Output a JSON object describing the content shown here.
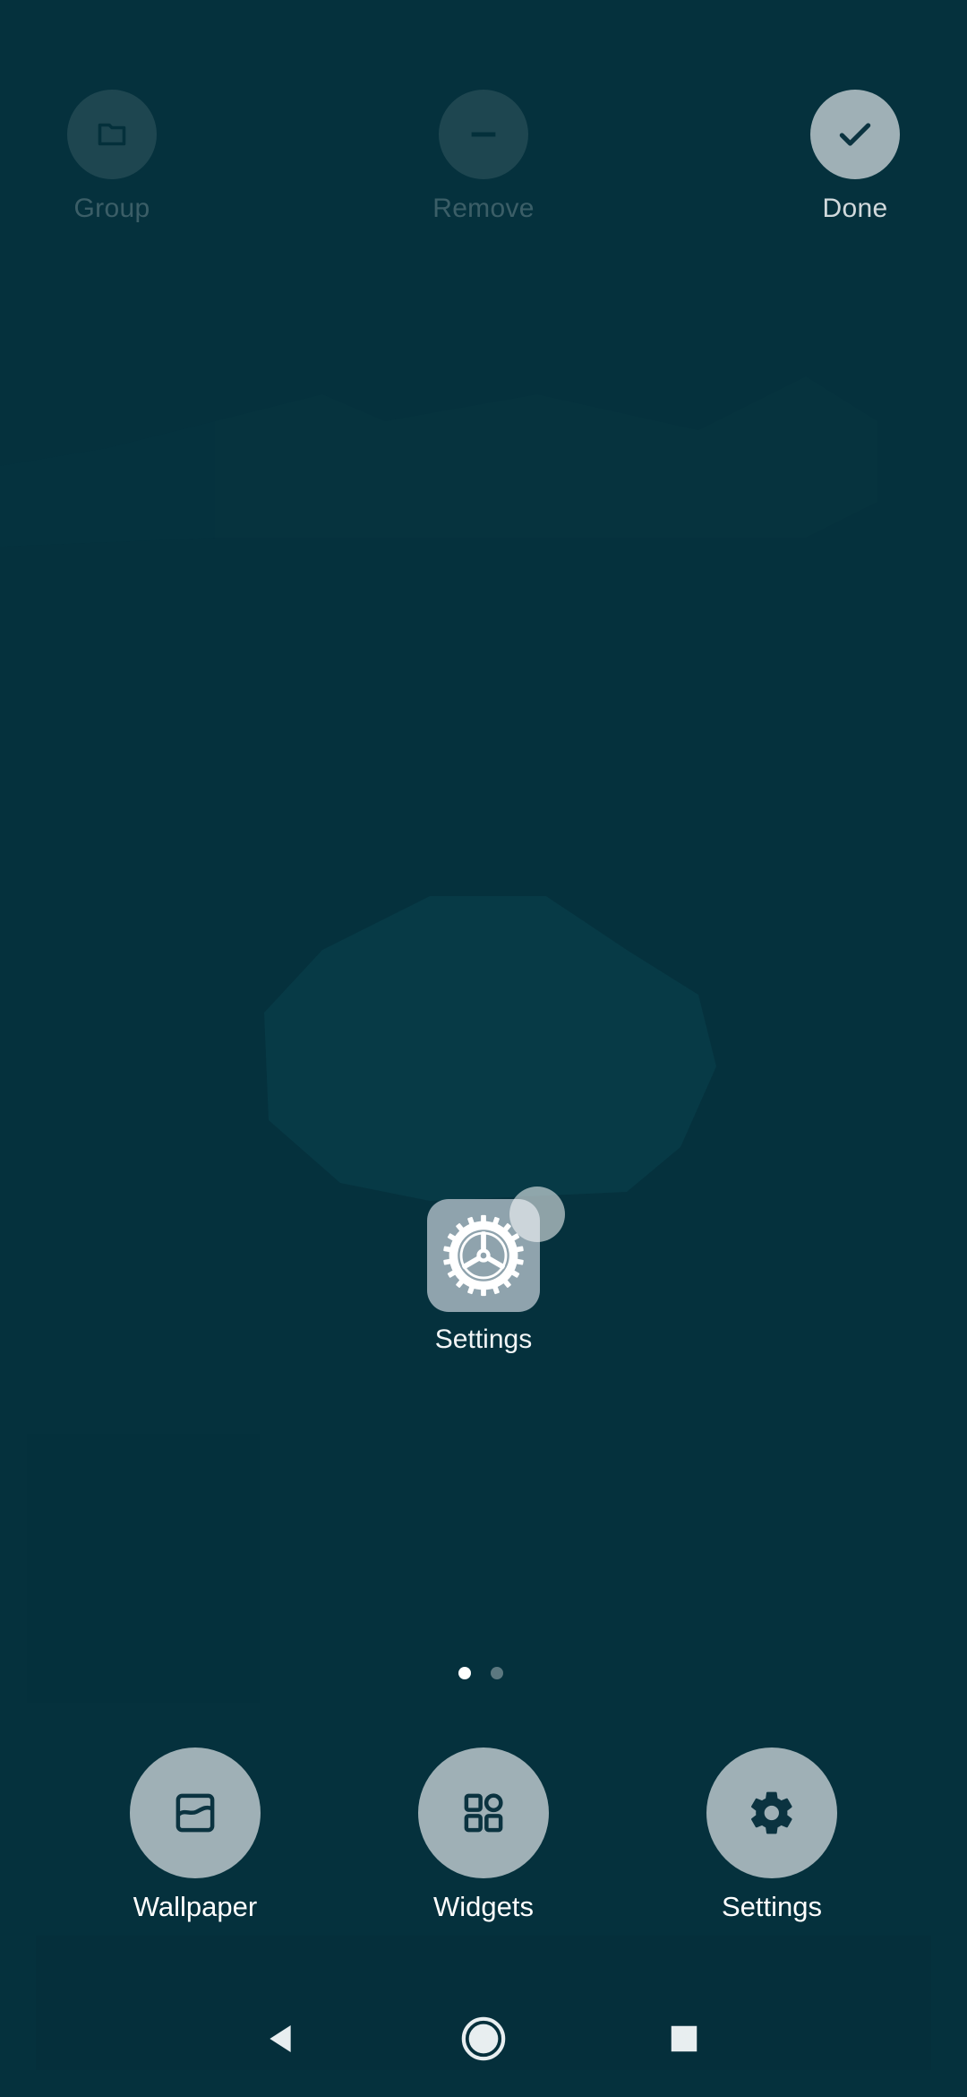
{
  "top_actions": {
    "group": {
      "label": "Group",
      "icon": "folder-icon",
      "enabled": false
    },
    "remove": {
      "label": "Remove",
      "icon": "minus-icon",
      "enabled": false
    },
    "done": {
      "label": "Done",
      "icon": "check-icon",
      "enabled": true
    }
  },
  "app": {
    "label": "Settings",
    "icon": "gear-icon"
  },
  "pager": {
    "current_page": 1,
    "total_pages": 2
  },
  "bottom_actions": {
    "wallpaper": {
      "label": "Wallpaper",
      "icon": "wallpaper-icon"
    },
    "widgets": {
      "label": "Widgets",
      "icon": "widgets-grid-icon"
    },
    "settings": {
      "label": "Settings",
      "icon": "gear-icon"
    }
  },
  "navigation": {
    "back": "back-triangle-icon",
    "home": "home-circle-icon",
    "recents": "recents-square-icon"
  },
  "colors": {
    "background": "#05313d",
    "button_fill": "#9fb0b6",
    "icon_dark": "#0b3340"
  }
}
